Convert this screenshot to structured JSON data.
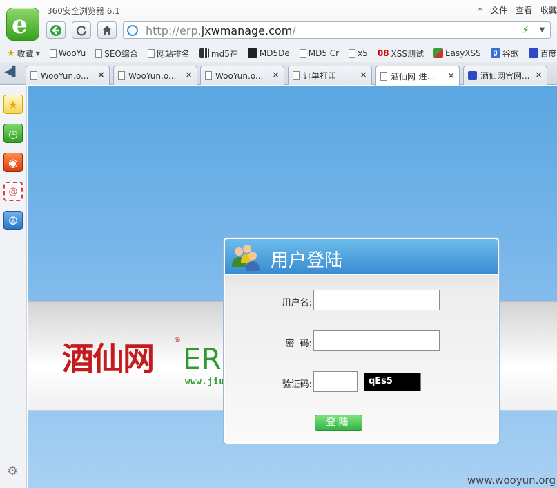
{
  "browser": {
    "app_title": "360安全浏览器 6.1",
    "menu": [
      "文件",
      "查看",
      "收藏"
    ],
    "url": {
      "prefix": "http://erp.",
      "domain": "jxwmanage.com",
      "suffix": "/"
    }
  },
  "bookmarks": [
    {
      "label": "收藏",
      "icon": "star-icon"
    },
    {
      "label": "WooYu",
      "icon": "page-icon"
    },
    {
      "label": "SEO综合",
      "icon": "page-icon"
    },
    {
      "label": "网站排名",
      "icon": "page-icon"
    },
    {
      "label": "md5在",
      "icon": "grid-icon"
    },
    {
      "label": "MD5De",
      "icon": "black-square-icon"
    },
    {
      "label": "MD5 Cr",
      "icon": "page-icon"
    },
    {
      "label": "x5",
      "icon": "page-icon"
    },
    {
      "label": "XSS测试",
      "icon": "08-icon"
    },
    {
      "label": "EasyXSS",
      "icon": "puzzle-icon"
    },
    {
      "label": "谷歌",
      "icon": "google-icon"
    },
    {
      "label": "百度",
      "icon": "baidu-icon"
    }
  ],
  "tabs": [
    {
      "label": "WooYun.o..."
    },
    {
      "label": "WooYun.o..."
    },
    {
      "label": "WooYun.o..."
    },
    {
      "label": "订单打印"
    },
    {
      "label": "酒仙网-进..."
    },
    {
      "label": "酒仙网官网..."
    }
  ],
  "page": {
    "brand_cn": "酒仙网",
    "brand_reg": "®",
    "brand_erp": "ERF",
    "brand_www": "www.jiu",
    "dialog": {
      "title": "用户登陆",
      "username_label": "用户名:",
      "password_label": "密  码:",
      "captcha_label": "验证码:",
      "captcha_text": "qEs5",
      "login_label": "登陆"
    }
  },
  "watermark": "www.wooyun.org",
  "colors": {
    "accent": "#3a8cd1",
    "brand_red": "#c41c1c",
    "brand_green": "#2d9b2d",
    "login_green": "#34b544"
  }
}
